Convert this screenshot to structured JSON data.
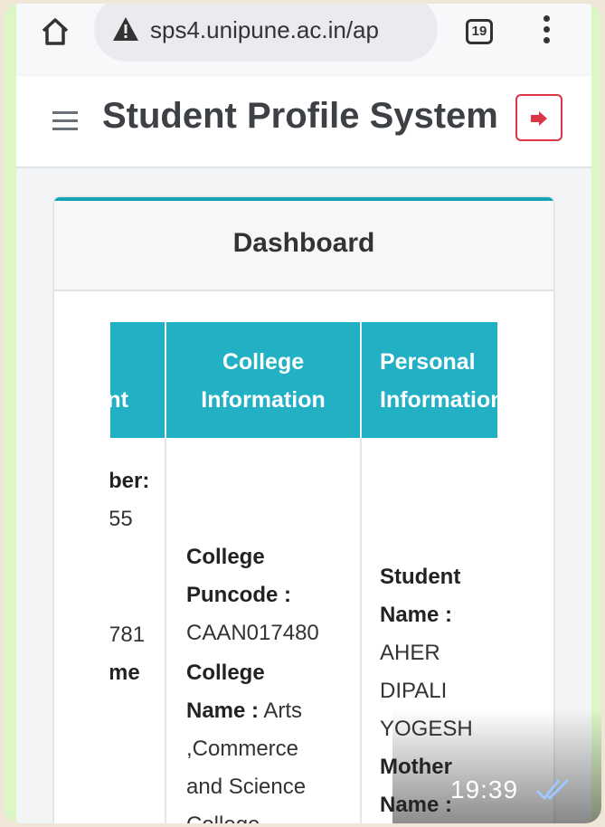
{
  "browser": {
    "url": "sps4.unipune.ac.in/ap",
    "tab_count": "19"
  },
  "app": {
    "title": "Student Profile System"
  },
  "card": {
    "title": "Dashboard"
  },
  "table": {
    "headers": [
      {
        "line1": "",
        "line2": "nt"
      },
      {
        "line1": "College",
        "line2": "Information"
      },
      {
        "line1": "Personal",
        "line2": "Information"
      }
    ],
    "col0_lines": [
      "ber:",
      "55",
      "781",
      "me"
    ],
    "col1": {
      "puncode_label": "College Puncode :",
      "puncode_value": "CAAN017480",
      "name_label": "College Name :",
      "name_value": "Arts ,Commerce and Science College"
    },
    "col2": {
      "student_name_label": "Student Name :",
      "student_name_value": "AHER DIPALI YOGESH",
      "mother_name_label": "Mother Name :"
    }
  },
  "message": {
    "time": "19:39"
  },
  "colors": {
    "accent": "#17a2b8",
    "header_bg": "#22b0c4",
    "logout": "#dc3545"
  }
}
